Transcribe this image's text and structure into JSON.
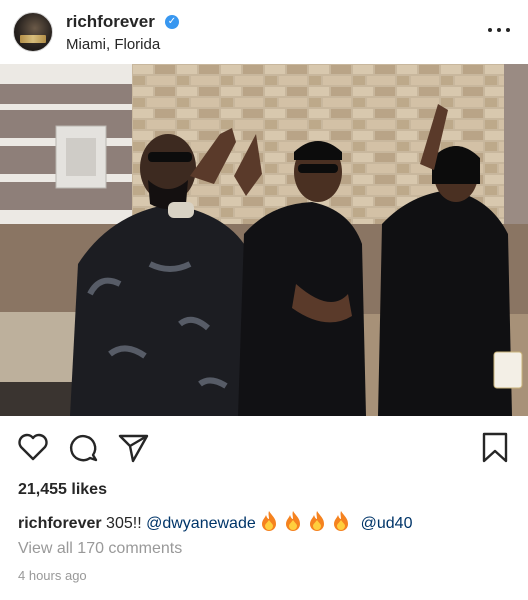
{
  "post": {
    "username": "richforever",
    "verified": true,
    "location": "Miami, Florida",
    "likes": "21,455 likes",
    "caption": {
      "username": "richforever",
      "text_before": "305!!",
      "mention1": "@dwyanewade",
      "emoji": [
        "fire",
        "fire",
        "fire",
        "fire"
      ],
      "mention2": "@ud40"
    },
    "view_comments": "View all 170 comments",
    "timestamp": "4 hours ago"
  },
  "icons": {
    "like": "heart-icon",
    "comment": "comment-icon",
    "share": "paper-plane-icon",
    "save": "bookmark-icon",
    "more": "more-horizontal-icon",
    "verified": "verified-badge-icon"
  },
  "colors": {
    "verified": "#3897f0",
    "mention": "#003569",
    "muted": "#999999",
    "text": "#262626"
  }
}
